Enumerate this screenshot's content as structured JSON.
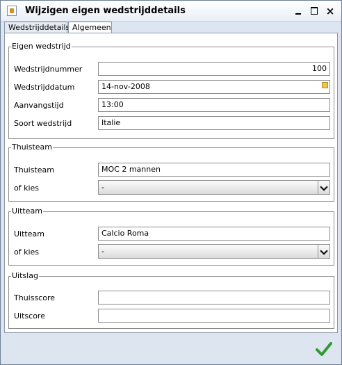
{
  "window": {
    "title": "Wijzigen eigen wedstrijddetails",
    "close_glyph": "×"
  },
  "tabs": [
    {
      "label": "Wedstrijddetails",
      "selected": false
    },
    {
      "label": "Algemeen",
      "selected": true
    }
  ],
  "groups": {
    "eigen": {
      "legend": "Eigen wedstrijd",
      "fields": [
        {
          "label": "Wedstrijdnummer",
          "value": "100"
        },
        {
          "label": "Wedstrijddatum",
          "value": "14-nov-2008"
        },
        {
          "label": "Aanvangstijd",
          "value": "13:00"
        },
        {
          "label": "Soort wedstrijd",
          "value": "Italie"
        }
      ]
    },
    "thuis": {
      "legend": "Thuisteam",
      "label": "Thuisteam",
      "value": "MOC 2 mannen",
      "choose_label": "of kies",
      "choose_value": "-"
    },
    "uit": {
      "legend": "Uitteam",
      "label": "Uitteam",
      "value": "Calcio Roma",
      "choose_label": "of kies",
      "choose_value": "-"
    },
    "uitslag": {
      "legend": "Uitslag",
      "fields": [
        {
          "label": "Thuisscore",
          "value": ""
        },
        {
          "label": "Uitscore",
          "value": ""
        }
      ]
    }
  },
  "colors": {
    "ok_check": "#2f9a2f",
    "window_bg": "#dde6f0"
  },
  "icons": {
    "app": "java-cup-icon",
    "date_picker": "calendar-icon",
    "ok": "checkmark-icon"
  }
}
